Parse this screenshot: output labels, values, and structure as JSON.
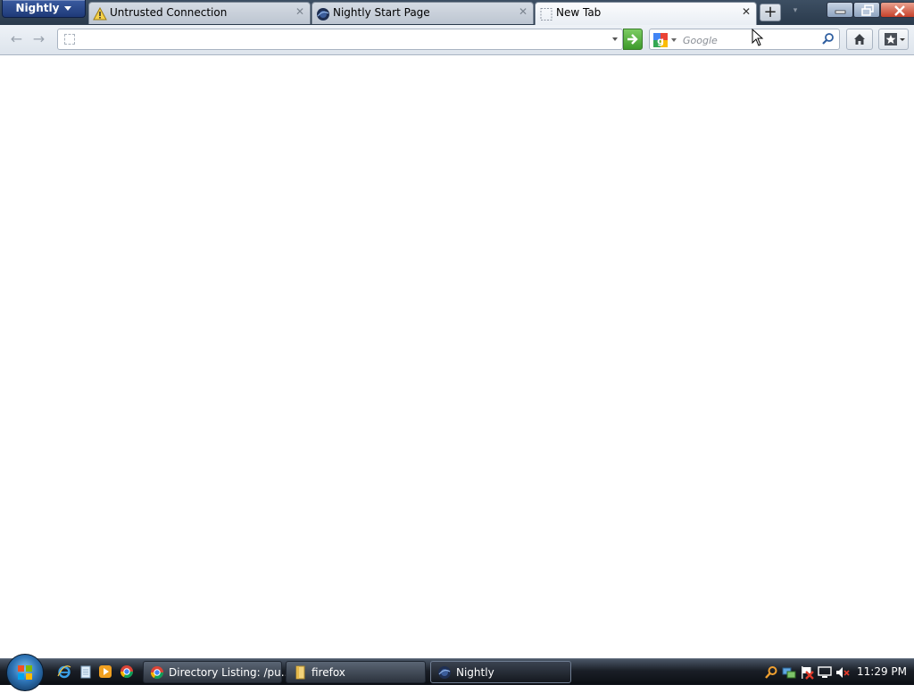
{
  "browser": {
    "app_menu_label": "Nightly",
    "tabs": [
      {
        "label": "Untrusted Connection",
        "icon": "warning-icon",
        "selected": false
      },
      {
        "label": "Nightly Start Page",
        "icon": "nightly-globe-icon",
        "selected": false
      },
      {
        "label": "New Tab",
        "icon": "blank-page-icon",
        "selected": true
      }
    ],
    "new_tab_icon": "plus-icon",
    "window_controls": [
      "minimize-icon",
      "restore-icon",
      "close-icon"
    ]
  },
  "navbar": {
    "url_value": "",
    "search_placeholder": "Google",
    "search_engine_icon": "google-icon"
  },
  "taskbar": {
    "quick_launch": [
      "internet-explorer-icon",
      "notepad-icon",
      "media-player-icon",
      "chrome-icon"
    ],
    "tasks": [
      {
        "label": "Directory Listing: /pu...",
        "icon": "chrome-icon",
        "active": false
      },
      {
        "label": "firefox",
        "icon": "folder-icon",
        "active": false
      },
      {
        "label": "Nightly",
        "icon": "nightly-globe-icon",
        "active": true
      }
    ],
    "clock": "11:29 PM"
  },
  "colors": {
    "tabstrip_bg": "#2a3a4c",
    "go_button": "#3d9a2b",
    "close_button": "#c6412a"
  }
}
